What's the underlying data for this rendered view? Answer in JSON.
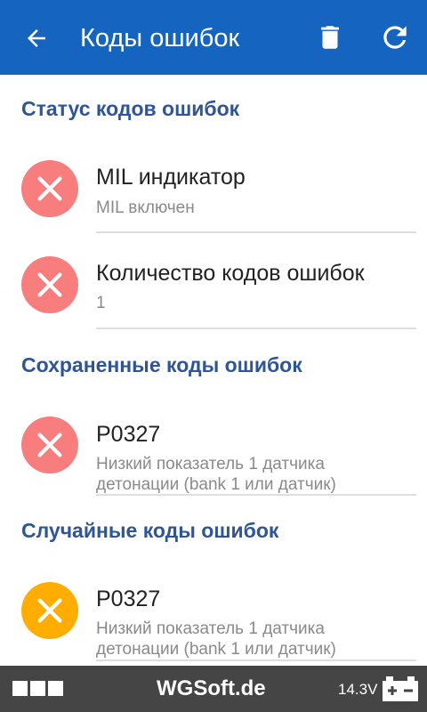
{
  "header": {
    "title": "Коды ошибок",
    "back_icon": "arrow-back-icon",
    "actions": [
      "trash-icon",
      "refresh-icon"
    ],
    "background": "#1565c0"
  },
  "sections": {
    "status": {
      "title": "Статус кодов ошибок",
      "items": [
        {
          "primary": "MIL индикатор",
          "secondary": "MIL включен",
          "state": "error"
        },
        {
          "primary": "Количество кодов ошибок",
          "secondary": "1",
          "state": "error"
        }
      ]
    },
    "stored": {
      "title": "Сохраненные коды ошибок",
      "items": [
        {
          "primary": "P0327",
          "secondary": "Низкий показатель 1 датчика детонации (bank 1 или датчик)",
          "state": "error"
        }
      ]
    },
    "pending": {
      "title": "Случайные коды ошибок",
      "items": [
        {
          "primary": "P0327",
          "secondary": "Низкий показатель 1 датчика детонации (bank 1 или датчик)",
          "state": "warning"
        }
      ]
    }
  },
  "colors": {
    "section_title": "#2e5596",
    "error": "#f87d7d",
    "warning": "#ffad03"
  },
  "footer": {
    "brand": "WGSoft.de",
    "voltage": "14.3V",
    "battery_icon": "car-battery-icon",
    "background": "#454545"
  }
}
